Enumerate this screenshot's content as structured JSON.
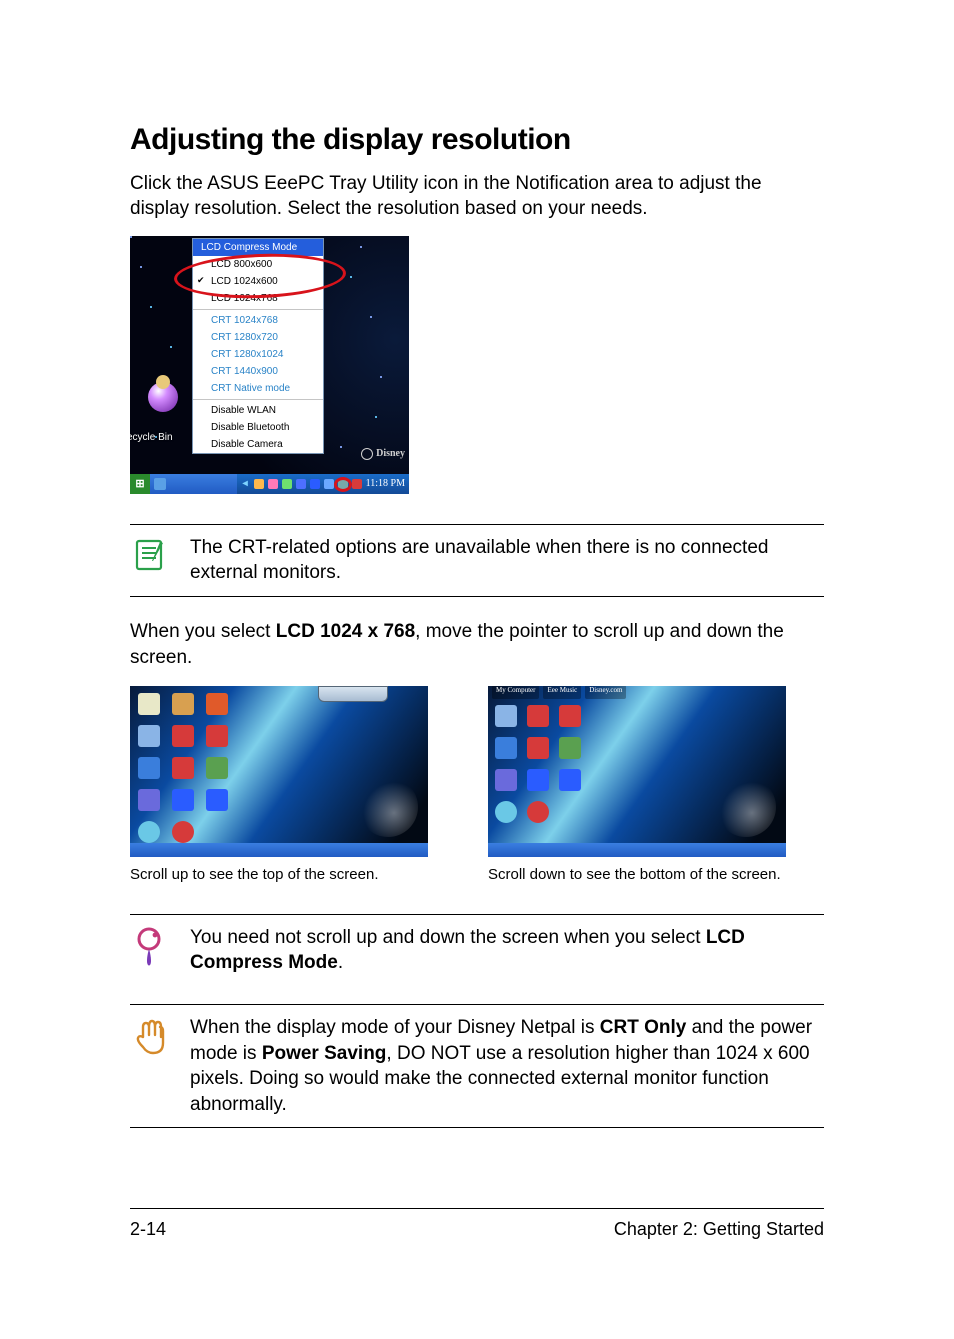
{
  "heading": "Adjusting the display resolution",
  "intro": "Click the ASUS EeePC Tray Utility icon in the Notification area to adjust the display resolution. Select the resolution based on your needs.",
  "tray_menu": {
    "title": "LCD Compress Mode",
    "items_lcd": [
      "LCD 800x600",
      "LCD 1024x600",
      "LCD 1024x768"
    ],
    "checked_index": 1,
    "items_crt": [
      "CRT 1024x768",
      "CRT 1280x720",
      "CRT 1280x1024",
      "CRT 1440x900",
      "CRT Native mode"
    ],
    "items_toggle": [
      "Disable WLAN",
      "Disable Bluetooth",
      "Disable Camera"
    ]
  },
  "tray_desktop_label": "ecycle Bin",
  "tray_disney": "Disney",
  "tray_clock": "11:18 PM",
  "note1": "The CRT-related options are unavailable when there is no connected external monitors.",
  "midpara_pre": "When you select ",
  "midpara_bold": "LCD 1024 x 768",
  "midpara_post": ", move the pointer to scroll up and down the screen.",
  "shot_a_caption": "Scroll up to see the top of the screen.",
  "shot_b_caption": "Scroll down to see the bottom of the screen.",
  "shot_b_toprow": [
    "My Computer",
    "Eee Music",
    "Disney.com"
  ],
  "note2_pre": "You need not scroll up and down the screen when you select ",
  "note2_b1": "LCD Compress Mode",
  "note2_post": ".",
  "note3_pre": "When the display mode of your Disney Netpal is ",
  "note3_b1": "CRT Only",
  "note3_mid": " and the power mode is ",
  "note3_b2": "Power Saving",
  "note3_post": ", DO NOT use a resolution higher than 1024 x 600 pixels. Doing so would make the connected external monitor function abnormally.",
  "footer_left": "2-14",
  "footer_right": "Chapter 2: Getting Started"
}
